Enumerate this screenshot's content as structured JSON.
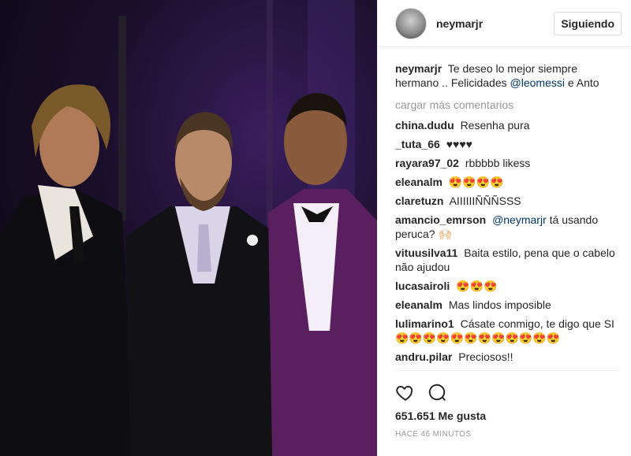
{
  "post": {
    "username": "neymarjr",
    "follow_label": "Siguiendo",
    "caption": {
      "author": "neymarjr",
      "text_before": "Te deseo lo mejor siempre hermano .. Felicidades",
      "mention": "@leomessi",
      "text_after": "e Anto"
    },
    "load_more": "cargar más comentarios",
    "comments": [
      {
        "author": "china.dudu",
        "text": "Resenha pura"
      },
      {
        "author": "_tuta_66",
        "text": "♥♥♥♥"
      },
      {
        "author": "rayara97_02",
        "text": "rbbbbb likess"
      },
      {
        "author": "eleanalm",
        "text": "😍😍😍😍"
      },
      {
        "author": "claretuzn",
        "text": "AIIIIIIÑÑÑSSS"
      },
      {
        "author": "amancio_emrson",
        "mention": "@neymarjr",
        "text": "tá usando peruca? 🙌🏻"
      },
      {
        "author": "vituusilva11",
        "text": "Baita estilo, pena que o cabelo não ajudou"
      },
      {
        "author": "lucasairoli",
        "text": "😍😍😍"
      },
      {
        "author": "eleanalm",
        "text": "Mas lindos imposible"
      },
      {
        "author": "lulimarino1",
        "text": "Cásate conmigo, te digo que SI 😍😍😍😍😍😍😍😍😍😍😍😍"
      },
      {
        "author": "andru.pilar",
        "text": "Preciosos!!"
      }
    ],
    "likes": "651.651 Me gusta",
    "time": "HACE 46 MINUTOS",
    "icons": {
      "like": "heart-icon",
      "comment": "comment-icon"
    }
  }
}
